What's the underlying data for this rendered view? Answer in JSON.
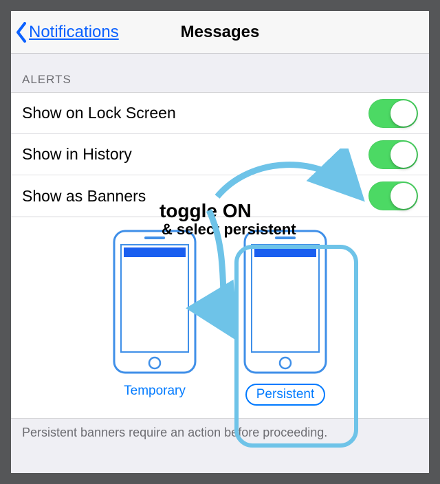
{
  "nav": {
    "back_label": "Notifications",
    "title": "Messages"
  },
  "section": {
    "header": "ALERTS"
  },
  "rows": [
    {
      "label": "Show on Lock Screen",
      "on": true
    },
    {
      "label": "Show in History",
      "on": true
    },
    {
      "label": "Show as Banners",
      "on": true
    }
  ],
  "banner_styles": {
    "temporary_label": "Temporary",
    "persistent_label": "Persistent",
    "selected": "persistent"
  },
  "footer": "Persistent banners require an action before proceeding.",
  "annotation": {
    "line1": "toggle ON",
    "line2": "& select persistent"
  },
  "colors": {
    "tint": "#007aff",
    "toggle_on": "#4cd964",
    "annotation_arrow": "#6ec3e8"
  }
}
